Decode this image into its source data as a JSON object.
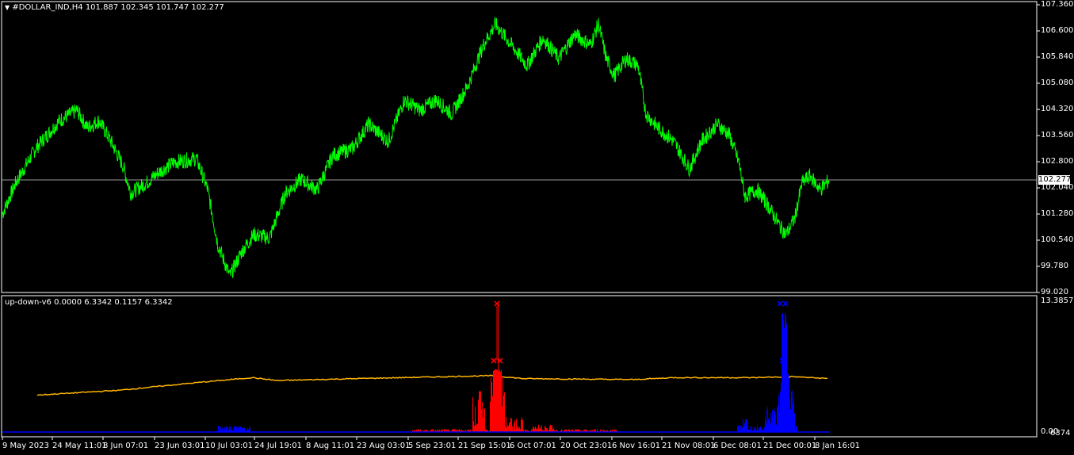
{
  "main_chart": {
    "header": "#DOLLAR_IND,H4  101.887 102.345 101.747 102.277",
    "current_price": "102.277",
    "price_axis": [
      "107.360",
      "106.600",
      "105.840",
      "105.080",
      "104.320",
      "103.560",
      "102.800",
      "102.040",
      "101.280",
      "100.540",
      "99.780",
      "99.020"
    ]
  },
  "indicator": {
    "header": "up-down-v6 0.0000 6.3342 0.1157 6.3342",
    "axis_max": "13.3857",
    "axis_min": "0.00",
    "axis_min_overlap": "6374"
  },
  "time_axis": [
    "9 May 2023",
    "24 May 11:01",
    "8 Jun 07:01",
    "23 Jun 03:01",
    "10 Jul 03:01",
    "24 Jul 19:01",
    "8 Aug 11:01",
    "23 Aug 03:01",
    "5 Sep 23:01",
    "21 Sep 15:01",
    "6 Oct 07:01",
    "20 Oct 23:01",
    "6 Nov 16:01",
    "21 Nov 08:01",
    "6 Dec 08:01",
    "21 Dec 00:01",
    "8 Jan 16:01"
  ],
  "colors": {
    "background": "#000000",
    "price_line": "#00ff00",
    "average_line": "#ffb400",
    "up_histogram": "#ff0000",
    "down_histogram": "#0000ff",
    "frame": "#ffffff"
  },
  "chart_data": [
    {
      "type": "line",
      "title": "#DOLLAR_IND,H4",
      "ylim": [
        99.02,
        107.36
      ],
      "x": [
        "9 May 2023",
        "24 May 11:01",
        "8 Jun 07:01",
        "23 Jun 03:01",
        "10 Jul 03:01",
        "24 Jul 19:01",
        "8 Aug 11:01",
        "23 Aug 03:01",
        "5 Sep 23:01",
        "21 Sep 15:01",
        "6 Oct 07:01",
        "20 Oct 23:01",
        "6 Nov 16:01",
        "21 Nov 08:01",
        "6 Dec 08:01",
        "21 Dec 00:01",
        "8 Jan 16:01"
      ],
      "series": [
        {
          "name": "#DOLLAR_IND",
          "values": [
            101.3,
            104.2,
            103.7,
            103.0,
            101.5,
            101.9,
            102.4,
            103.7,
            104.8,
            106.2,
            106.3,
            106.5,
            104.6,
            103.5,
            103.8,
            101.1,
            102.28
          ]
        }
      ]
    },
    {
      "type": "bar",
      "title": "up-down-v6",
      "ylim": [
        0,
        13.3857
      ],
      "series": [
        {
          "name": "up",
          "peak_index": 9,
          "peak_value": 13.3857
        },
        {
          "name": "down",
          "peak_index": 15,
          "peak_value": 13.3857
        },
        {
          "name": "average",
          "level": 6.3342
        }
      ]
    }
  ]
}
